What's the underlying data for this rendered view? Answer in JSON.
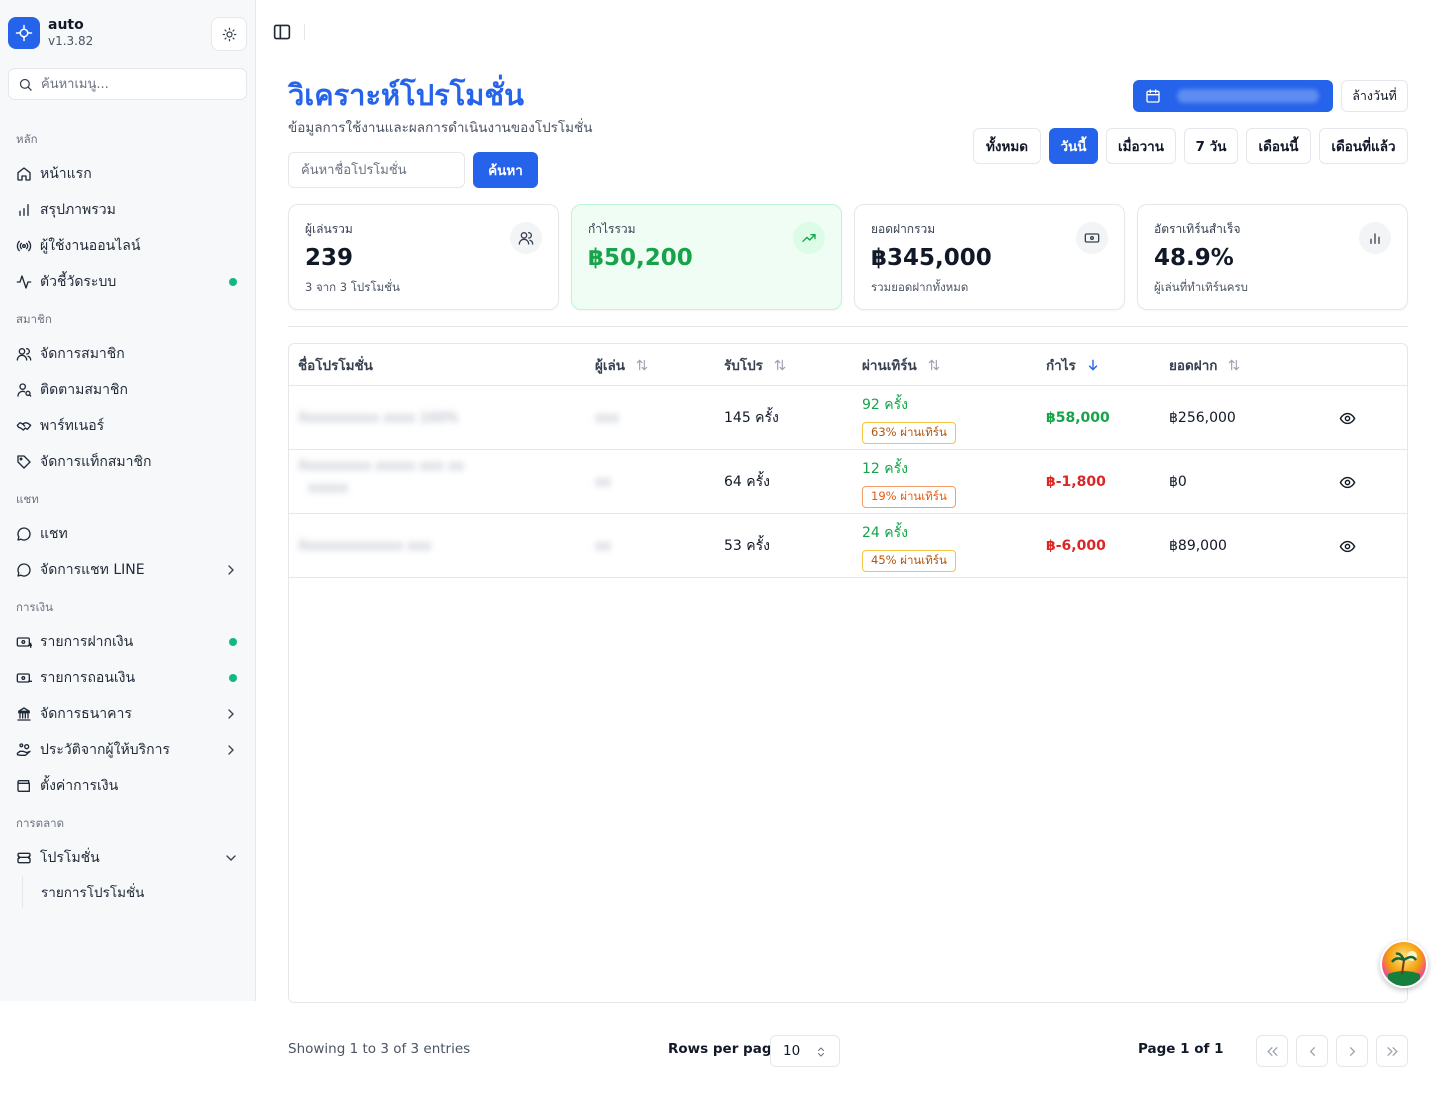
{
  "app": {
    "name": "auto",
    "version": "v1.3.82"
  },
  "sidebar": {
    "search_placeholder": "ค้นหาเมนู...",
    "groups": [
      {
        "label": "หลัก",
        "items": [
          {
            "label": "หน้าแรก",
            "icon": "home-icon"
          },
          {
            "label": "สรุปภาพรวม",
            "icon": "bar-chart-icon"
          },
          {
            "label": "ผู้ใช้งานออนไลน์",
            "icon": "radio-icon"
          },
          {
            "label": "ตัวชี้วัดระบบ",
            "icon": "activity-icon",
            "status_dot": true
          }
        ]
      },
      {
        "label": "สมาชิก",
        "items": [
          {
            "label": "จัดการสมาชิก",
            "icon": "users-icon"
          },
          {
            "label": "ติดตามสมาชิก",
            "icon": "user-search-icon"
          },
          {
            "label": "พาร์ทเนอร์",
            "icon": "handshake-icon"
          },
          {
            "label": "จัดการแท็กสมาชิก",
            "icon": "tag-icon"
          }
        ]
      },
      {
        "label": "แชท",
        "items": [
          {
            "label": "แชท",
            "icon": "message-circle-icon"
          },
          {
            "label": "จัดการแชท LINE",
            "icon": "message-circle-icon",
            "chevron": "right"
          }
        ]
      },
      {
        "label": "การเงิน",
        "items": [
          {
            "label": "รายการฝากเงิน",
            "icon": "deposit-icon",
            "status_dot": true
          },
          {
            "label": "รายการถอนเงิน",
            "icon": "withdraw-icon",
            "status_dot": true
          },
          {
            "label": "จัดการธนาคาร",
            "icon": "bank-icon",
            "chevron": "right"
          },
          {
            "label": "ประวัติจากผู้ให้บริการ",
            "icon": "hand-coins-icon",
            "chevron": "right"
          },
          {
            "label": "ตั้งค่าการเงิน",
            "icon": "wallet-icon"
          }
        ]
      },
      {
        "label": "การตลาด",
        "items": [
          {
            "label": "โปรโมชั่น",
            "icon": "ticket-icon",
            "chevron": "down"
          }
        ]
      }
    ],
    "sub_item": "รายการโปรโมชั่น"
  },
  "header": {
    "title": "วิเคราะห์โปรโมชั่น",
    "subtitle": "ข้อมูลการใช้งานและผลการดำเนินงานของโปรโมชั่น",
    "clear_date": "ล้างวันที่",
    "ranges": [
      "ทั้งหมด",
      "วันนี้",
      "เมื่อวาน",
      "7 วัน",
      "เดือนนี้",
      "เดือนที่แล้ว"
    ],
    "active_range": "วันนี้"
  },
  "search": {
    "placeholder": "ค้นหาชื่อโปรโมชั่น",
    "button": "ค้นหา"
  },
  "stats": [
    {
      "label": "ผู้เล่นรวม",
      "value": "239",
      "desc": "3 จาก 3 โปรโมชั่น",
      "icon": "users-icon"
    },
    {
      "label": "กำไรรวม",
      "value": "฿50,200",
      "desc": "",
      "icon": "trending-up-icon",
      "highlight": true
    },
    {
      "label": "ยอดฝากรวม",
      "value": "฿345,000",
      "desc": "รวมยอดฝากทั้งหมด",
      "icon": "banknote-icon"
    },
    {
      "label": "อัตราเทิร์นสำเร็จ",
      "value": "48.9%",
      "desc": "ผู้เล่นที่ทำเทิร์นครบ",
      "icon": "bar-chart-icon"
    }
  ],
  "table": {
    "columns": [
      "ชื่อโปรโมชั่น",
      "ผู้เล่น",
      "รับโปร",
      "ผ่านเทิร์น",
      "กำไร",
      "ยอดฝาก"
    ],
    "rows": [
      {
        "name": "Xxxxxxxxxx xxxx 100%",
        "name2": "",
        "players": "xxx",
        "claims": "145 ครั้ง",
        "turn_count": "92 ครั้ง",
        "turn_badge": "63% ผ่านเทิร์น",
        "profit": "฿58,000",
        "profit_sign": "pos",
        "deposit": "฿256,000"
      },
      {
        "name": "Xxxxxxxxx xxxxx xxx xx",
        "name2": "xxxxx",
        "players": "xx",
        "claims": "64 ครั้ง",
        "turn_count": "12 ครั้ง",
        "turn_badge": "19% ผ่านเทิร์น",
        "profit": "฿-1,800",
        "profit_sign": "neg",
        "deposit": "฿0"
      },
      {
        "name": "Xxxxxxxxxxxxx xxx",
        "name2": "",
        "players": "xx",
        "claims": "53 ครั้ง",
        "turn_count": "24 ครั้ง",
        "turn_badge": "45% ผ่านเทิร์น",
        "profit": "฿-6,000",
        "profit_sign": "neg",
        "deposit": "฿89,000"
      }
    ]
  },
  "footer": {
    "showing": "Showing 1 to 3 of 3 entries",
    "rows_per_page_label": "Rows per page",
    "rows_per_page": "10",
    "page": "Page 1 of 1"
  },
  "colors": {
    "accent": "#2563eb",
    "positive": "#16a34a",
    "negative": "#dc2626",
    "dot": "#10b981"
  }
}
